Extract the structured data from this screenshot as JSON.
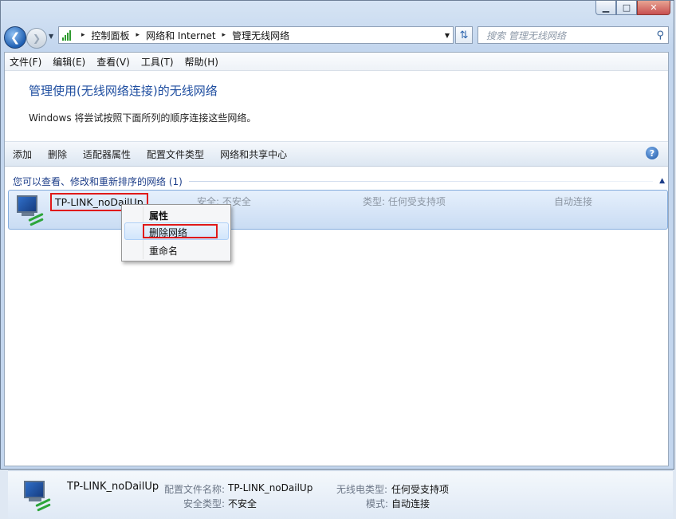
{
  "window": {
    "minimize": "▁",
    "maximize": "□",
    "close": "✕",
    "faint_tabs": [
      "",
      ""
    ]
  },
  "address": {
    "sep": "▸",
    "crumbs": [
      "控制面板",
      "网络和 Internet",
      "管理无线网络"
    ],
    "search_placeholder": "搜索 管理无线网络"
  },
  "menu": [
    "文件(F)",
    "编辑(E)",
    "查看(V)",
    "工具(T)",
    "帮助(H)"
  ],
  "header": {
    "title": "管理使用(无线网络连接)的无线网络",
    "description": "Windows 将尝试按照下面所列的顺序连接这些网络。"
  },
  "toolbar": [
    "添加",
    "删除",
    "适配器属性",
    "配置文件类型",
    "网络和共享中心"
  ],
  "group": {
    "label": "您可以查看、修改和重新排序的网络 (1)"
  },
  "network": {
    "name": "TP-LINK_noDailUp",
    "security": "安全: 不安全",
    "type": "类型: 任何受支持项",
    "mode": "自动连接"
  },
  "context_menu": [
    "属性",
    "删除网络",
    "重命名"
  ],
  "details": {
    "name": "TP-LINK_noDailUp",
    "profile_label": "配置文件名称:",
    "profile_value": "TP-LINK_noDailUp",
    "security_label": "安全类型:",
    "security_value": "不安全",
    "radio_label": "无线电类型:",
    "radio_value": "任何受支持项",
    "mode_label": "模式:",
    "mode_value": "自动连接"
  },
  "icons": {
    "back": "back-arrow-icon",
    "forward": "forward-arrow-icon",
    "network": "wireless-network-icon",
    "help": "help-icon",
    "search": "search-icon",
    "refresh": "refresh-icon"
  }
}
